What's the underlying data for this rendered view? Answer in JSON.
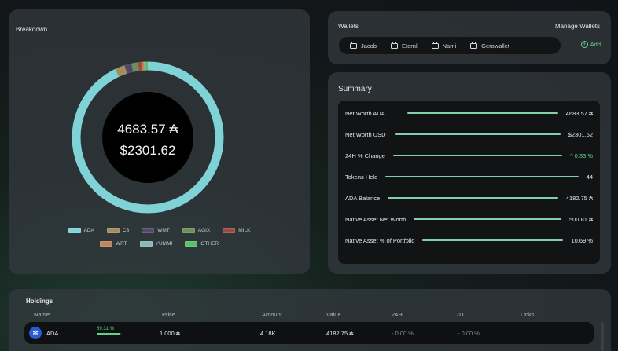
{
  "breakdown": {
    "title": "Breakdown",
    "center_ada": "4683.57 ₳",
    "center_usd": "$2301.62",
    "legend": [
      {
        "label": "ADA",
        "color": "#7fd3d7",
        "fraction": 0.9291
      },
      {
        "label": "C3",
        "color": "#a38c5f",
        "fraction": 0.021
      },
      {
        "label": "WMT",
        "color": "#52486c",
        "fraction": 0.015
      },
      {
        "label": "AGIX",
        "color": "#6f8f58",
        "fraction": 0.014
      },
      {
        "label": "MILK",
        "color": "#a04a45",
        "fraction": 0.008
      },
      {
        "label": "WRT",
        "color": "#c2845a",
        "fraction": 0.005
      },
      {
        "label": "YUMMI",
        "color": "#8ab8b5",
        "fraction": 0.003
      },
      {
        "label": "OTHER",
        "color": "#5cbf6a",
        "fraction": 0.0049
      }
    ]
  },
  "wallets": {
    "title": "Wallets",
    "manage_label": "Manage Wallets",
    "add_label": "Add",
    "items": [
      "Jacob",
      "Eternl",
      "Nami",
      "Gerowallet"
    ]
  },
  "summary": {
    "title": "Summary",
    "rows": [
      {
        "label": "Net Worth ADA",
        "value": "4683.57 ₳"
      },
      {
        "label": "Net Worth USD",
        "value": "$2301.62"
      },
      {
        "label": "24H % Change",
        "value": "^ 0.33 %"
      },
      {
        "label": "Tokens Held",
        "value": "44"
      },
      {
        "label": "ADA Balance",
        "value": "4182.75 ₳"
      },
      {
        "label": "Native Asset Net Worth",
        "value": "500.81 ₳"
      },
      {
        "label": "Native Asset % of Portfolio",
        "value": "10.69 %"
      }
    ]
  },
  "holdings": {
    "title": "Holdings",
    "columns": [
      "Name",
      "Price",
      "Amount",
      "Value",
      "24H",
      "7D",
      "Links"
    ],
    "rows": [
      {
        "name": "ADA",
        "share": "89.31 %",
        "share_fraction": 0.8931,
        "price": "1.000 ₳",
        "amount": "4.18K",
        "value": "4182.75 ₳",
        "change_24h": "- 0.00 %",
        "change_7d": "- 0.00 %"
      }
    ]
  },
  "colors": {
    "accent_green": "#5fd38d",
    "summary_line": "#7fd1a8",
    "ada_blue": "#2a5bd6"
  }
}
